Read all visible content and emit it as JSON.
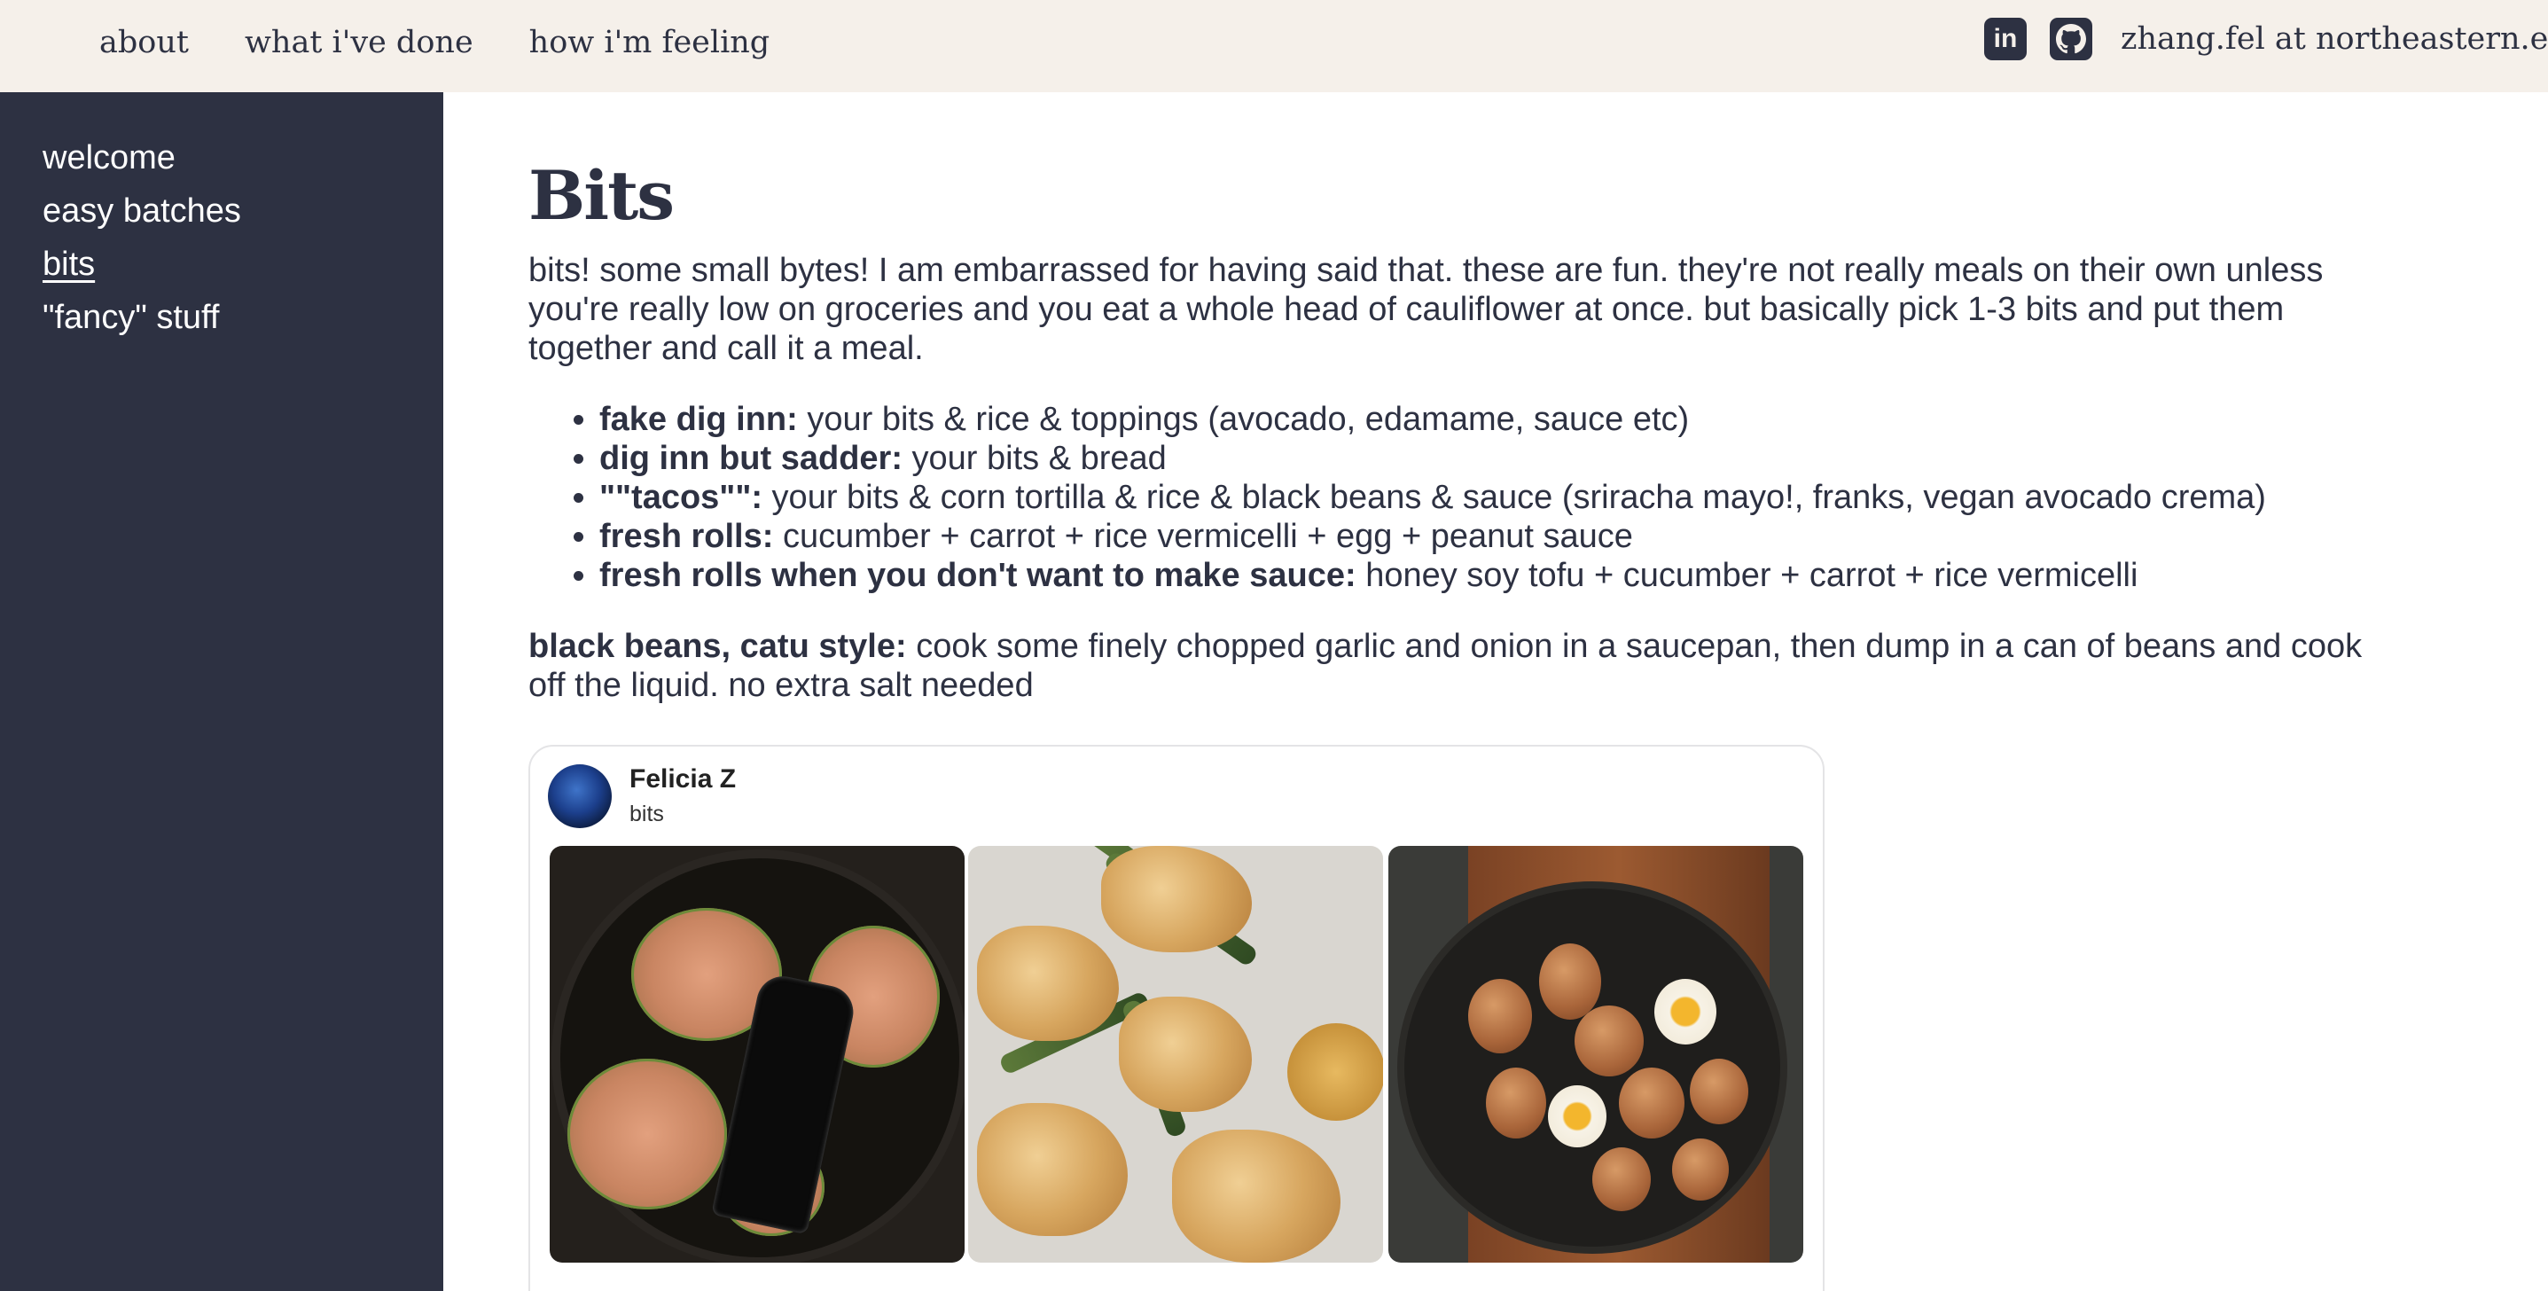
{
  "topnav": {
    "items": [
      "about",
      "what i've done",
      "how i'm feeling"
    ]
  },
  "social": {
    "linkedin_label": "in",
    "github_icon": "github-icon",
    "email": "zhang.fel at northeastern.edu"
  },
  "sidebar": {
    "items": [
      {
        "label": "welcome"
      },
      {
        "label": "easy batches"
      },
      {
        "label": "bits",
        "active": true
      },
      {
        "label": "\"fancy\" stuff"
      }
    ]
  },
  "main": {
    "title": "Bits",
    "intro": "bits! some small bytes! I am embarrassed for having said that. these are fun. they're not really meals on their own unless you're really low on groceries and you eat a whole head of cauliflower at once. but basically pick 1-3 bits and put them together and call it a meal.",
    "list": [
      {
        "term": "fake dig inn:",
        "desc": " your bits & rice & toppings (avocado, edamame, sauce etc)"
      },
      {
        "term": "dig inn but sadder:",
        "desc": " your bits & bread"
      },
      {
        "term": "\"\"tacos\"\":",
        "desc": " your bits & corn tortilla & rice & black beans & sauce (sriracha mayo!, franks, vegan avocado crema)"
      },
      {
        "term": "fresh rolls:",
        "desc": " cucumber + carrot + rice vermicelli + egg + peanut sauce"
      },
      {
        "term": "fresh rolls when you don't want to make sauce:",
        "desc": " honey soy tofu + cucumber + carrot + rice vermicelli"
      }
    ],
    "beans": {
      "term": "black beans, catu style:",
      "desc": " cook some finely chopped garlic and onion in a saucepan, then dump in a can of beans and cook off the liquid. no extra salt needed"
    }
  },
  "card": {
    "name": "Felicia Z",
    "board": "bits"
  },
  "colors": {
    "sidebar_bg": "#2d3142",
    "topbar_bg": "#f5f0ea",
    "text": "#2d3142"
  }
}
